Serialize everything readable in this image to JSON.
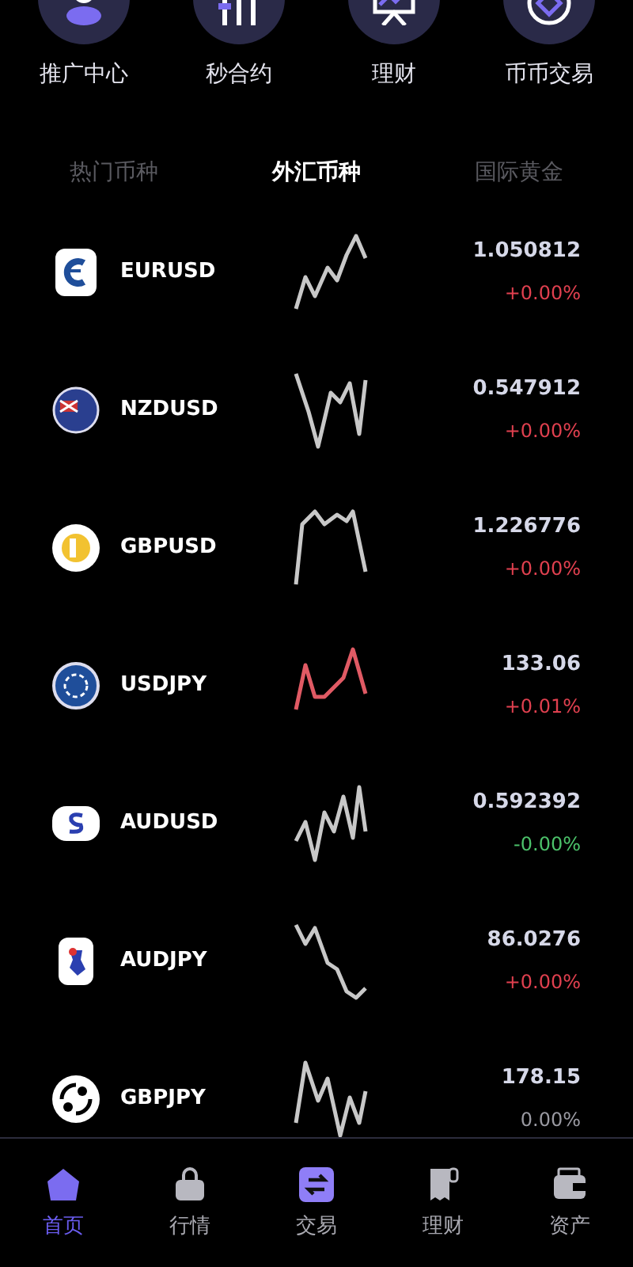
{
  "quick_menu": [
    {
      "label": "推广中心"
    },
    {
      "label": "秒合约"
    },
    {
      "label": "理财"
    },
    {
      "label": "币币交易"
    }
  ],
  "tabs": [
    {
      "label": "热门币种",
      "selected": false
    },
    {
      "label": "外汇币种",
      "selected": true
    },
    {
      "label": "国际黄金",
      "selected": false
    }
  ],
  "rows": [
    {
      "name": "EURUSD",
      "price": "1.050812",
      "change": {
        "text": "+0.00%",
        "color": "#e0404f"
      },
      "sparkline": {
        "color": "#c8c8c8"
      }
    },
    {
      "name": "NZDUSD",
      "price": "0.547912",
      "change": {
        "text": "+0.00%",
        "color": "#e0404f"
      },
      "sparkline": {
        "color": "#c8c8c8"
      }
    },
    {
      "name": "GBPUSD",
      "price": "1.226776",
      "change": {
        "text": "+0.00%",
        "color": "#e0404f"
      },
      "sparkline": {
        "color": "#c8c8c8"
      }
    },
    {
      "name": "USDJPY",
      "price": "133.06",
      "change": {
        "text": "+0.01%",
        "color": "#e0404f"
      },
      "sparkline": {
        "color": "#e05a64"
      }
    },
    {
      "name": "AUDUSD",
      "price": "0.592392",
      "change": {
        "text": "-0.00%",
        "color": "#4cc26a"
      },
      "sparkline": {
        "color": "#c8c8c8"
      }
    },
    {
      "name": "AUDJPY",
      "price": "86.0276",
      "change": {
        "text": "+0.00%",
        "color": "#e0404f"
      },
      "sparkline": {
        "color": "#c8c8c8"
      }
    },
    {
      "name": "GBPJPY",
      "price": "178.15",
      "change": {
        "text": "0.00%",
        "color": "#9a9aa2"
      },
      "sparkline": {
        "color": "#c8c8c8"
      }
    }
  ],
  "bottom_nav": [
    {
      "label": "首页",
      "selected": true
    },
    {
      "label": "行情",
      "selected": false
    },
    {
      "label": "交易",
      "selected": false
    },
    {
      "label": "理财",
      "selected": false
    },
    {
      "label": "资产",
      "selected": false
    }
  ]
}
